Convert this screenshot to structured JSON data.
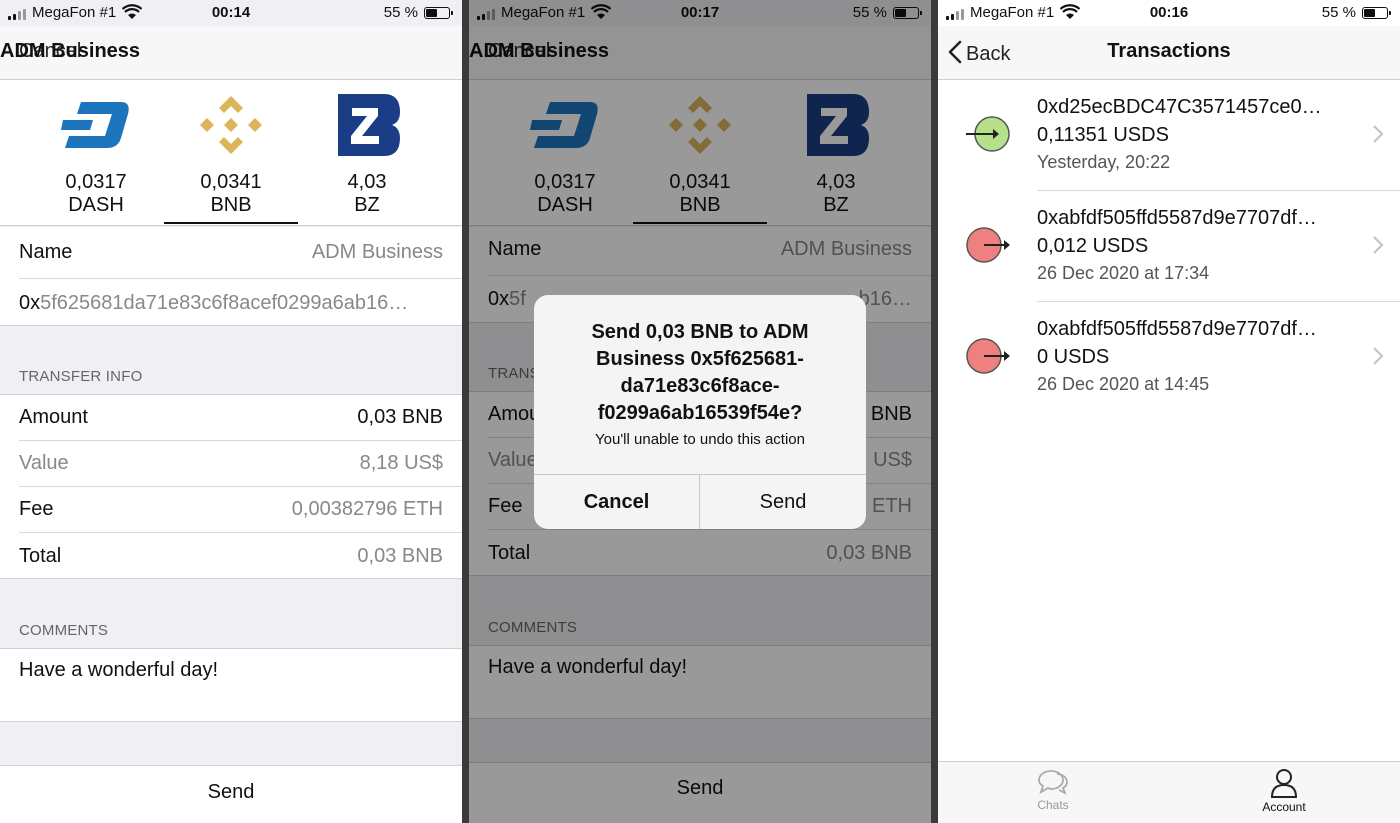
{
  "status_bars": [
    {
      "carrier": "MegaFon #1",
      "time": "00:14",
      "battery": "55 %"
    },
    {
      "carrier": "MegaFon #1",
      "time": "00:17",
      "battery": "55 %"
    },
    {
      "carrier": "MegaFon #1",
      "time": "00:16",
      "battery": "55 %"
    }
  ],
  "send_screen": {
    "cancel_label": "Cancel",
    "title": "ADM Business",
    "wallets": [
      {
        "balance": "0,0317",
        "symbol": "DASH",
        "icon": "dash-logo-icon",
        "color": "#1c75bc"
      },
      {
        "balance": "0,0341",
        "symbol": "BNB",
        "icon": "binance-logo-icon",
        "color": "#dcb45a"
      },
      {
        "balance": "4,03",
        "symbol": "BZ",
        "icon": "bitzeny-logo-icon",
        "color": "#1b3d86"
      }
    ],
    "name_label": "Name",
    "name_value": "ADM Business",
    "address_prefix": "0x",
    "address_rest": "5f625681da71e83c6f8acef0299a6ab16…",
    "address_rest_covered": "5f625681da71e83c6f8acef0299a6ab16…",
    "transfer_info_header": "TRANSFER INFO",
    "amount_label": "Amount",
    "amount_value": "0,03 BNB",
    "value_label": "Value",
    "value_value": "8,18 US$",
    "fee_label": "Fee",
    "fee_value": "0,00382796 ETH",
    "total_label": "Total",
    "total_value": "0,03 BNB",
    "comments_header": "COMMENTS",
    "comment": "Have a wonderful day!",
    "send_label": "Send"
  },
  "confirm_screen": {
    "amount_label_cut": "Amou",
    "amount_value_cut": "BNB",
    "value_label_cut": "Value",
    "value_value_cut": "US$",
    "fee_value_cut": "ETH",
    "transfer_header_cut": "TRANS",
    "address_prefix_covered": "0x",
    "address_left_cut": "5f",
    "address_right_cut": "b16…",
    "alert": {
      "title": "Send 0,03 BNB to ADM Business 0x5f625681-da71e83c6f8ace-f0299a6ab16539f54e?",
      "message": "You'll unable to undo this action",
      "cancel": "Cancel",
      "send": "Send"
    }
  },
  "transactions_screen": {
    "back_label": "Back",
    "title": "Transactions",
    "items": [
      {
        "address": "0xd25ecBDC47C3571457ce0…",
        "amount": "0,11351 USDS",
        "date": "Yesterday, 20:22",
        "direction": "incoming",
        "color": "#b6e08c"
      },
      {
        "address": "0xabfdf505ffd5587d9e7707df…",
        "amount": "0,012 USDS",
        "date": "26 Dec 2020 at 17:34",
        "direction": "outgoing",
        "color": "#ee8080"
      },
      {
        "address": "0xabfdf505ffd5587d9e7707df…",
        "amount": "0 USDS",
        "date": "26 Dec 2020 at 14:45",
        "direction": "outgoing",
        "color": "#ee8080"
      }
    ],
    "tabs": [
      {
        "label": "Chats",
        "icon": "chats-icon"
      },
      {
        "label": "Account",
        "icon": "account-icon"
      }
    ]
  }
}
